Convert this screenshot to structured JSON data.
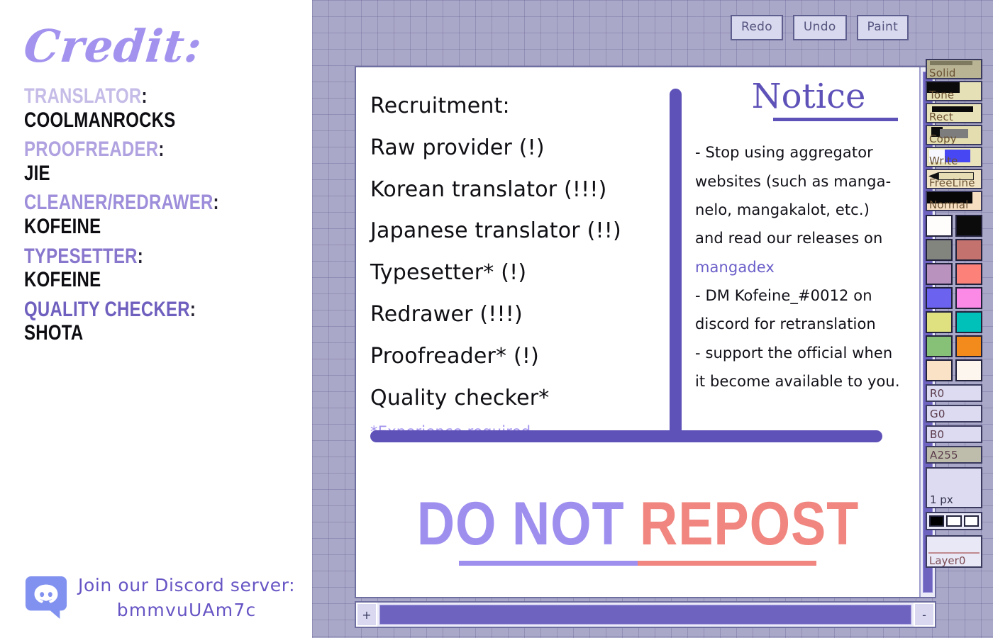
{
  "credits": {
    "title": "Credit:",
    "entries": [
      {
        "role": "TRANSLATOR",
        "name": "COOLMANROCKS",
        "color": "#c6bce8"
      },
      {
        "role": "PROOFREADER",
        "name": "JIE",
        "color": "#b0a2e0"
      },
      {
        "role": "CLEANER/REDRAWER",
        "name": "KOFEINE",
        "color": "#9d8dda"
      },
      {
        "role": "TYPESETTER",
        "name": "KOFEINE",
        "color": "#8877cd"
      },
      {
        "role": "QUALITY CHECKER",
        "name": "SHOTA",
        "color": "#6f5fbe"
      }
    ],
    "colon": ":",
    "discord": {
      "icon": "discord-icon",
      "invite_prompt": "Join our Discord server:",
      "invite_code": "bmmvuUAm7c",
      "brand_color": "#8191ef"
    }
  },
  "paint_app": {
    "top_toolbar": [
      {
        "label": "Redo",
        "name": "redo-button"
      },
      {
        "label": "Undo",
        "name": "undo-button"
      },
      {
        "label": "Paint",
        "name": "paint-button"
      }
    ],
    "canvas": {
      "recruitment": {
        "heading": "Recruitment:",
        "items": [
          "Raw provider (!)",
          "Korean translator (!!!)",
          "Japanese translator (!!)",
          "Typesetter* (!)",
          "Redrawer (!!!)",
          "Proofreader* (!)",
          "Quality checker*"
        ],
        "footnote": "*Experience required"
      },
      "notice": {
        "title": "Notice",
        "lines": [
          {
            "text": "- Stop using aggregator",
            "link": false
          },
          {
            "text": "websites (such as manga-",
            "link": false
          },
          {
            "text": "nelo, mangakalot, etc.)",
            "link": false
          },
          {
            "text": "and read our releases on",
            "link": false
          },
          {
            "text": "mangadex",
            "link": true
          },
          {
            "text": "- DM Kofeine_#0012 on",
            "link": false
          },
          {
            "text": "discord for retranslation",
            "link": false
          },
          {
            "text": "- support the official when",
            "link": false
          },
          {
            "text": "it become available to you.",
            "link": false
          }
        ]
      },
      "watermark": {
        "part1": "DO NOT ",
        "part2": "REPOST",
        "part1_color": "#9e8fef",
        "part2_color": "#f0867f"
      }
    },
    "scrollbars": {
      "h_left_button": "+",
      "h_right_button": "-"
    },
    "tool_palette": {
      "tools": [
        {
          "label": "Solid",
          "name": "tool-solid"
        },
        {
          "label": "Tone",
          "name": "tool-tone"
        },
        {
          "label": "Rect",
          "name": "tool-rect"
        },
        {
          "label": "Copy",
          "name": "tool-copy"
        },
        {
          "label": "Write",
          "name": "tool-write"
        },
        {
          "label": "FreeLine",
          "name": "tool-freeline"
        },
        {
          "label": "Normal",
          "name": "tool-normal"
        }
      ],
      "colors": [
        "#fefdfb",
        "#0b0b0b",
        "#82847e",
        "#c4726d",
        "#b992bd",
        "#fb8179",
        "#6b63ef",
        "#fb8ae6",
        "#dfe181",
        "#00c1ba",
        "#87c177",
        "#f38a1c",
        "#fae2c7",
        "#fdf6ee"
      ],
      "channels": [
        {
          "label": "R0",
          "name": "red-channel-value"
        },
        {
          "label": "G0",
          "name": "green-channel-value"
        },
        {
          "label": "B0",
          "name": "blue-channel-value"
        },
        {
          "label": "A255",
          "name": "alpha-channel-value"
        }
      ],
      "brush_size": "1 px",
      "mini_swatches": [
        "#000000",
        "#ffffff",
        "#ffffff"
      ],
      "layer_label": "Layer0"
    }
  }
}
